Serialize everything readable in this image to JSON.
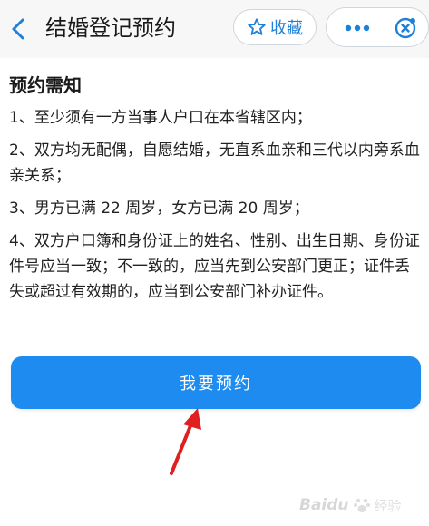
{
  "header": {
    "title": "结婚登记预约",
    "favorite_label": "收藏",
    "icons": {
      "back": "chevron-left-icon",
      "favorite": "star-icon",
      "more": "more-dots-icon",
      "close": "close-target-icon"
    }
  },
  "content": {
    "section_title": "预约需知",
    "items": [
      "1、至少须有一方当事人户口在本省辖区内；",
      "2、双方均无配偶，自愿结婚，无直系血亲和三代以内旁系血亲关系；",
      "3、男方已满 22 周岁，女方已满 20 周岁；",
      "4、双方户口簿和身份证上的姓名、性别、出生日期、身份证件号应当一致；不一致的，应当先到公安部门更正；证件丢失或超过有效期的，应当到公安部门补办证件。"
    ]
  },
  "action": {
    "reserve_label": "我要预约"
  },
  "watermark": {
    "brand": "Baidu",
    "sub": "经验"
  },
  "colors": {
    "accent": "#1d8bf0",
    "link_blue": "#1f80d8",
    "arrow_red": "#e02020"
  }
}
